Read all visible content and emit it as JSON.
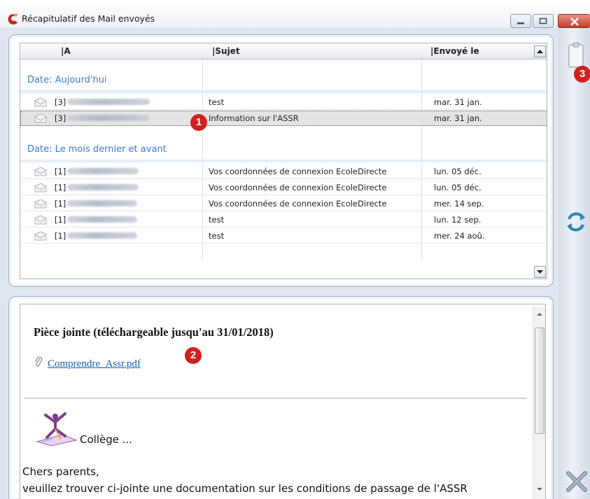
{
  "window": {
    "title": "Récapitulatif des Mail envoyés"
  },
  "list": {
    "columns": [
      "|A",
      "|Sujet",
      "|Envoyé le"
    ],
    "groups": [
      {
        "label": "Date: Aujourd'hui",
        "rows": [
          {
            "count": "[3]",
            "subject": "test",
            "sent": "mar. 31 jan.",
            "selected": false
          },
          {
            "count": "[3]",
            "subject": "Information sur l'ASSR",
            "sent": "mar. 31 jan.",
            "selected": true
          }
        ]
      },
      {
        "label": "Date: Le mois dernier et avant",
        "rows": [
          {
            "count": "[1]",
            "subject": "Vos coordonnées de connexion EcoleDirecte",
            "sent": "lun. 05 déc.",
            "selected": false
          },
          {
            "count": "[1]",
            "subject": "Vos coordonnées de connexion EcoleDirecte",
            "sent": "lun. 05 déc.",
            "selected": false
          },
          {
            "count": "[1]",
            "subject": "Vos coordonnées de connexion EcoleDirecte",
            "sent": "mer. 14 sep.",
            "selected": false
          },
          {
            "count": "[1]",
            "subject": "test",
            "sent": "lun. 12 sep.",
            "selected": false
          },
          {
            "count": "[1]",
            "subject": "test",
            "sent": "mer. 24 aoû.",
            "selected": false
          }
        ]
      }
    ]
  },
  "preview": {
    "attachment_title": "Pièce jointe (téléchargeable jusqu'au 31/01/2018)",
    "attachment_file": "Comprendre_Assr.pdf",
    "school": "Collège ...",
    "greeting": "Chers parents,",
    "body": "veuillez trouver ci-jointe une documentation sur les conditions de passage de l'ASSR"
  },
  "annotations": {
    "badge1": "1",
    "badge2": "2",
    "badge3": "3"
  },
  "icons": {
    "app": "app-logo-icon",
    "row": "envelope-icon",
    "attachment": "paperclip-icon",
    "side": [
      "clipboard-icon",
      "refresh-icon",
      "tools-icon"
    ]
  },
  "colors": {
    "group_label": "#3a7bc8",
    "link": "#1b5ea8",
    "badge": "#d02020",
    "close_button": "#c8402c"
  }
}
